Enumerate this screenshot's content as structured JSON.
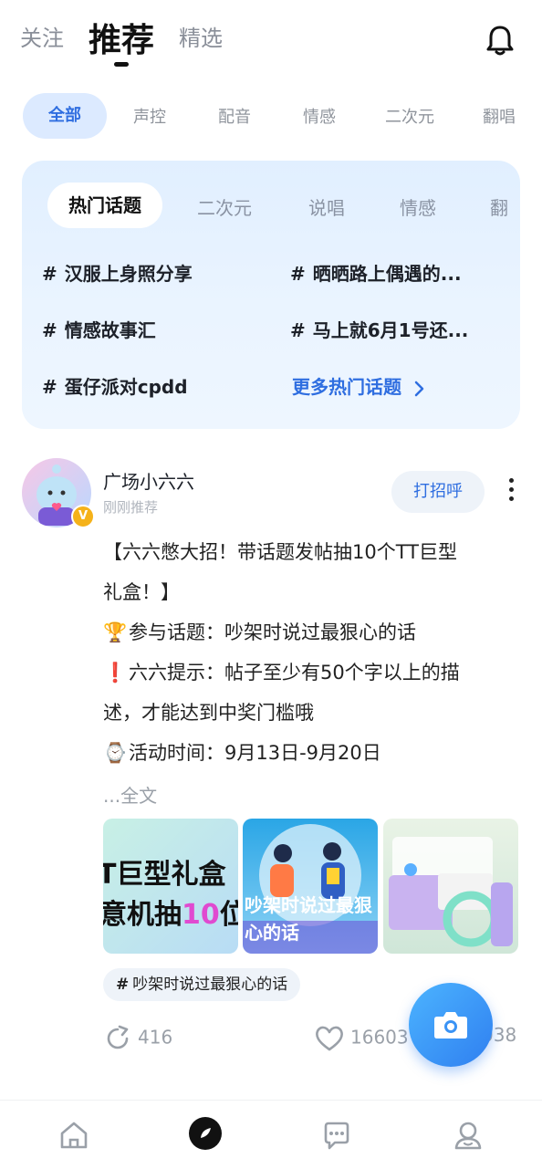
{
  "top_tabs": {
    "follow": "关注",
    "recommend": "推荐",
    "selected": "精选"
  },
  "categories": [
    "全部",
    "声控",
    "配音",
    "情感",
    "二次元",
    "翻唱"
  ],
  "hot_card": {
    "tabs": [
      "热门话题",
      "二次元",
      "说唱",
      "情感",
      "翻"
    ],
    "topics": [
      "汉服上身照分享",
      "晒晒路上偶遇的...",
      "情感故事汇",
      "马上就6月1号还...",
      "蛋仔派对cpdd"
    ],
    "hash": "#",
    "more": "更多热门话题"
  },
  "post": {
    "author": "广场小六六",
    "time": "刚刚推荐",
    "greet_button": "打招呼",
    "lines": [
      "【六六憋大招！带话题发帖抽10个TT巨型",
      "礼盒！】",
      "参与话题：吵架时说过最狠心的话",
      "六六提示：帖子至少有50个字以上的描",
      "述，才能达到中奖门槛哦",
      "活动时间：9月13日-9月20日"
    ],
    "emojis": [
      "🏆",
      "❗",
      "⌚"
    ],
    "full_text": "...全文",
    "thumb1_line1": "T巨型礼盒",
    "thumb1_line2_a": "意机抽",
    "thumb1_line2_num": "10",
    "thumb1_line2_b": "位",
    "thumb2_caption": "吵架时说过最狠心的话",
    "tag": "吵架时说过最狠心的话",
    "shares": "416",
    "likes": "16603",
    "comments": "038"
  },
  "icons": {
    "bell": "bell-icon",
    "camera": "camera-icon",
    "home": "home-icon",
    "discover": "discover-icon",
    "messages": "chat-icon",
    "profile": "profile-icon"
  },
  "colors": {
    "accent": "#2f6ee0",
    "chip_bg": "#dceaff",
    "card_bg": "#e1efff",
    "fab": "#3a93f5"
  }
}
